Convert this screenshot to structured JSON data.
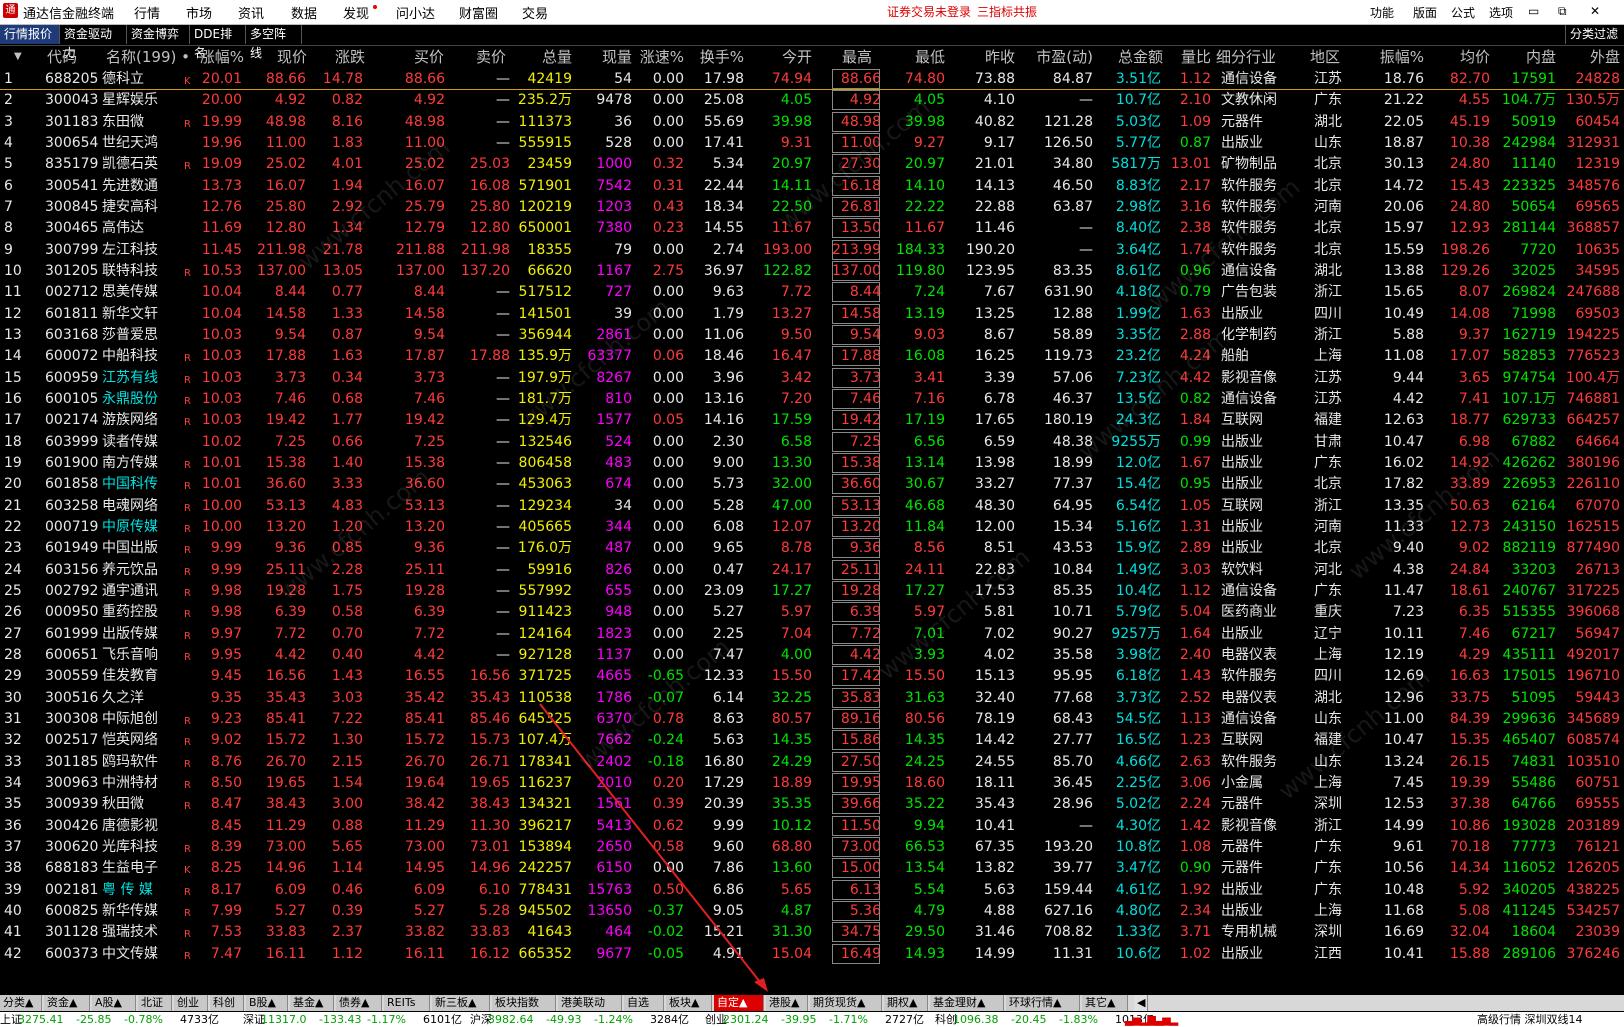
{
  "app": {
    "title": "通达信金融终端",
    "logo": "通"
  },
  "topmenu": [
    "行情",
    "市场",
    "资讯",
    "数据",
    "发现",
    "问小达",
    "财富圈",
    "交易"
  ],
  "alerts": [
    "证券交易未登录",
    "三指标共振"
  ],
  "rightmenu": [
    "功能",
    "版面",
    "公式",
    "选项"
  ],
  "tabs": [
    "行情报价",
    "资金驱动力",
    "资金博弈",
    "DDE排名",
    "多空阵线"
  ],
  "right_tab": "分类过滤",
  "headers": [
    "代码",
    "名称(199) •",
    "涨幅%",
    "现价",
    "涨跌",
    "买价",
    "卖价",
    "总量",
    "现量",
    "涨速%",
    "换手%",
    "今开",
    "最高",
    "最低",
    "昨收",
    "市盈(动)",
    "总金额",
    "量比",
    "细分行业",
    "地区",
    "振幅%",
    "均价",
    "内盘",
    "外盘"
  ],
  "rows": [
    [
      "1",
      "688205",
      "德科立",
      "K",
      "20.01",
      "88.66",
      "14.78",
      "88.66",
      "—",
      "42419",
      "54",
      "0.00",
      "17.98",
      "74.94",
      "88.66",
      "74.80",
      "73.88",
      "84.87",
      "3.51亿",
      "1.12",
      "通信设备",
      "江苏",
      "18.76",
      "82.70",
      "17591",
      "24828"
    ],
    [
      "2",
      "300043",
      "星辉娱乐",
      "",
      "20.00",
      "4.92",
      "0.82",
      "4.92",
      "—",
      "235.2万",
      "9478",
      "0.00",
      "25.08",
      "4.05",
      "4.92",
      "4.05",
      "4.10",
      "—",
      "10.7亿",
      "2.10",
      "文教休闲",
      "广东",
      "21.22",
      "4.55",
      "104.7万",
      "130.5万"
    ],
    [
      "3",
      "301183",
      "东田微",
      "R",
      "19.99",
      "48.98",
      "8.16",
      "48.98",
      "—",
      "111373",
      "36",
      "0.00",
      "55.69",
      "39.98",
      "48.98",
      "39.98",
      "40.82",
      "121.28",
      "5.03亿",
      "1.09",
      "元器件",
      "湖北",
      "22.05",
      "45.19",
      "50919",
      "60454"
    ],
    [
      "4",
      "300654",
      "世纪天鸿",
      "",
      "19.96",
      "11.00",
      "1.83",
      "11.00",
      "—",
      "555915",
      "528",
      "0.00",
      "17.41",
      "9.31",
      "11.00",
      "9.27",
      "9.17",
      "126.50",
      "5.77亿",
      "0.87",
      "出版业",
      "山东",
      "18.87",
      "10.38",
      "242984",
      "312931"
    ],
    [
      "5",
      "835179",
      "凯德石英",
      "R",
      "19.09",
      "25.02",
      "4.01",
      "25.02",
      "25.03",
      "23459",
      "1000",
      "0.32",
      "5.34",
      "20.97",
      "27.30",
      "20.97",
      "21.01",
      "34.80",
      "5817万",
      "13.01",
      "矿物制品",
      "北京",
      "30.13",
      "24.80",
      "11140",
      "12319"
    ],
    [
      "6",
      "300541",
      "先进数通",
      "",
      "13.73",
      "16.07",
      "1.94",
      "16.07",
      "16.08",
      "571901",
      "7542",
      "0.31",
      "22.44",
      "14.11",
      "16.18",
      "14.10",
      "14.13",
      "46.50",
      "8.83亿",
      "2.17",
      "软件服务",
      "北京",
      "14.72",
      "15.43",
      "223325",
      "348576"
    ],
    [
      "7",
      "300845",
      "捷安高科",
      "",
      "12.76",
      "25.80",
      "2.92",
      "25.79",
      "25.80",
      "120219",
      "1203",
      "0.43",
      "18.34",
      "22.50",
      "26.81",
      "22.22",
      "22.88",
      "63.87",
      "2.98亿",
      "3.16",
      "软件服务",
      "河南",
      "20.06",
      "24.80",
      "50654",
      "69565"
    ],
    [
      "8",
      "300465",
      "高伟达",
      "",
      "11.69",
      "12.80",
      "1.34",
      "12.79",
      "12.80",
      "650001",
      "7380",
      "0.23",
      "14.55",
      "11.67",
      "13.50",
      "11.67",
      "11.46",
      "—",
      "8.40亿",
      "2.38",
      "软件服务",
      "北京",
      "15.97",
      "12.93",
      "281144",
      "368857"
    ],
    [
      "9",
      "300799",
      "左江科技",
      "",
      "11.45",
      "211.98",
      "21.78",
      "211.88",
      "211.98",
      "18355",
      "79",
      "0.00",
      "2.74",
      "193.00",
      "213.99",
      "184.33",
      "190.20",
      "—",
      "3.64亿",
      "1.74",
      "软件服务",
      "北京",
      "15.59",
      "198.26",
      "7720",
      "10635"
    ],
    [
      "10",
      "301205",
      "联特科技",
      "R",
      "10.53",
      "137.00",
      "13.05",
      "137.00",
      "137.20",
      "66620",
      "1167",
      "2.75",
      "36.97",
      "122.82",
      "137.00",
      "119.80",
      "123.95",
      "83.35",
      "8.61亿",
      "0.96",
      "通信设备",
      "湖北",
      "13.88",
      "129.26",
      "32025",
      "34595"
    ],
    [
      "11",
      "002712",
      "思美传媒",
      "",
      "10.04",
      "8.44",
      "0.77",
      "8.44",
      "—",
      "517512",
      "727",
      "0.00",
      "9.63",
      "7.72",
      "8.44",
      "7.24",
      "7.67",
      "631.90",
      "4.18亿",
      "0.79",
      "广告包装",
      "浙江",
      "15.65",
      "8.07",
      "269824",
      "247688"
    ],
    [
      "12",
      "601811",
      "新华文轩",
      "",
      "10.04",
      "14.58",
      "1.33",
      "14.58",
      "—",
      "141501",
      "39",
      "0.00",
      "1.79",
      "13.27",
      "14.58",
      "13.19",
      "13.25",
      "12.88",
      "1.99亿",
      "1.63",
      "出版业",
      "四川",
      "10.49",
      "14.08",
      "71998",
      "69503"
    ],
    [
      "13",
      "603168",
      "莎普爱思",
      "",
      "10.03",
      "9.54",
      "0.87",
      "9.54",
      "—",
      "356944",
      "2861",
      "0.00",
      "11.06",
      "9.50",
      "9.54",
      "9.03",
      "8.67",
      "58.89",
      "3.35亿",
      "2.88",
      "化学制药",
      "浙江",
      "5.88",
      "9.37",
      "162719",
      "194225"
    ],
    [
      "14",
      "600072",
      "中船科技",
      "R",
      "10.03",
      "17.88",
      "1.63",
      "17.87",
      "17.88",
      "135.9万",
      "63377",
      "0.06",
      "18.46",
      "16.47",
      "17.88",
      "16.08",
      "16.25",
      "119.73",
      "23.2亿",
      "4.24",
      "船舶",
      "上海",
      "11.08",
      "17.07",
      "582853",
      "776523"
    ],
    [
      "15",
      "600959",
      "江苏有线",
      "R",
      "10.03",
      "3.73",
      "0.34",
      "3.73",
      "—",
      "197.9万",
      "8267",
      "0.00",
      "3.96",
      "3.42",
      "3.73",
      "3.41",
      "3.39",
      "57.06",
      "7.23亿",
      "4.42",
      "影视音像",
      "江苏",
      "9.44",
      "3.65",
      "974754",
      "100.4万"
    ],
    [
      "16",
      "600105",
      "永鼎股份",
      "R",
      "10.03",
      "7.46",
      "0.68",
      "7.46",
      "—",
      "181.7万",
      "810",
      "0.00",
      "13.16",
      "7.20",
      "7.46",
      "7.16",
      "6.78",
      "46.37",
      "13.5亿",
      "0.82",
      "通信设备",
      "江苏",
      "4.42",
      "7.41",
      "107.1万",
      "746881"
    ],
    [
      "17",
      "002174",
      "游族网络",
      "R",
      "10.03",
      "19.42",
      "1.77",
      "19.42",
      "—",
      "129.4万",
      "1577",
      "0.05",
      "14.16",
      "17.59",
      "19.42",
      "17.19",
      "17.65",
      "180.19",
      "24.3亿",
      "1.84",
      "互联网",
      "福建",
      "12.63",
      "18.77",
      "629733",
      "664257"
    ],
    [
      "18",
      "603999",
      "读者传媒",
      "",
      "10.02",
      "7.25",
      "0.66",
      "7.25",
      "—",
      "132546",
      "524",
      "0.00",
      "2.30",
      "6.58",
      "7.25",
      "6.56",
      "6.59",
      "48.38",
      "9255万",
      "0.99",
      "出版业",
      "甘肃",
      "10.47",
      "6.98",
      "67882",
      "64664"
    ],
    [
      "19",
      "601900",
      "南方传媒",
      "R",
      "10.01",
      "15.38",
      "1.40",
      "15.38",
      "—",
      "806458",
      "483",
      "0.00",
      "9.00",
      "13.30",
      "15.38",
      "13.14",
      "13.98",
      "18.99",
      "12.0亿",
      "1.67",
      "出版业",
      "广东",
      "16.02",
      "14.92",
      "426262",
      "380196"
    ],
    [
      "20",
      "601858",
      "中国科传",
      "R",
      "10.01",
      "36.60",
      "3.33",
      "36.60",
      "—",
      "453063",
      "674",
      "0.00",
      "5.73",
      "32.00",
      "36.60",
      "30.67",
      "33.27",
      "77.37",
      "15.4亿",
      "0.95",
      "出版业",
      "北京",
      "17.82",
      "33.89",
      "226953",
      "226110"
    ],
    [
      "21",
      "603258",
      "电魂网络",
      "R",
      "10.00",
      "53.13",
      "4.83",
      "53.13",
      "—",
      "129234",
      "34",
      "0.00",
      "5.28",
      "47.00",
      "53.13",
      "46.68",
      "48.30",
      "64.95",
      "6.54亿",
      "1.05",
      "互联网",
      "浙江",
      "13.35",
      "50.63",
      "62164",
      "67070"
    ],
    [
      "22",
      "000719",
      "中原传媒",
      "R",
      "10.00",
      "13.20",
      "1.20",
      "13.20",
      "—",
      "405665",
      "344",
      "0.00",
      "6.08",
      "12.07",
      "13.20",
      "11.84",
      "12.00",
      "15.34",
      "5.16亿",
      "1.31",
      "出版业",
      "河南",
      "11.33",
      "12.73",
      "243150",
      "162515"
    ],
    [
      "23",
      "601949",
      "中国出版",
      "R",
      "9.99",
      "9.36",
      "0.85",
      "9.36",
      "—",
      "176.0万",
      "487",
      "0.00",
      "9.65",
      "8.78",
      "9.36",
      "8.56",
      "8.51",
      "43.53",
      "15.9亿",
      "2.89",
      "出版业",
      "北京",
      "9.40",
      "9.02",
      "882119",
      "877490"
    ],
    [
      "24",
      "603156",
      "养元饮品",
      "R",
      "9.99",
      "25.11",
      "2.28",
      "25.11",
      "—",
      "59916",
      "826",
      "0.00",
      "0.47",
      "24.17",
      "25.11",
      "24.11",
      "22.83",
      "10.84",
      "1.49亿",
      "3.03",
      "软饮料",
      "河北",
      "4.38",
      "24.84",
      "33203",
      "26713"
    ],
    [
      "25",
      "002792",
      "通宇通讯",
      "R",
      "9.98",
      "19.28",
      "1.75",
      "19.28",
      "—",
      "557992",
      "655",
      "0.00",
      "23.09",
      "17.27",
      "19.28",
      "17.27",
      "17.53",
      "85.35",
      "10.4亿",
      "1.12",
      "通信设备",
      "广东",
      "11.47",
      "18.61",
      "240767",
      "317225"
    ],
    [
      "26",
      "000950",
      "重药控股",
      "R",
      "9.98",
      "6.39",
      "0.58",
      "6.39",
      "—",
      "911423",
      "948",
      "0.00",
      "5.27",
      "5.97",
      "6.39",
      "5.97",
      "5.81",
      "10.71",
      "5.79亿",
      "5.04",
      "医药商业",
      "重庆",
      "7.23",
      "6.35",
      "515355",
      "396068"
    ],
    [
      "27",
      "601999",
      "出版传媒",
      "R",
      "9.97",
      "7.72",
      "0.70",
      "7.72",
      "—",
      "124164",
      "1823",
      "0.00",
      "2.25",
      "7.04",
      "7.72",
      "7.01",
      "7.02",
      "90.27",
      "9257万",
      "1.64",
      "出版业",
      "辽宁",
      "10.11",
      "7.46",
      "67217",
      "56947"
    ],
    [
      "28",
      "600651",
      "飞乐音响",
      "R",
      "9.95",
      "4.42",
      "0.40",
      "4.42",
      "—",
      "927128",
      "1137",
      "0.00",
      "7.47",
      "4.00",
      "4.42",
      "3.93",
      "4.02",
      "35.58",
      "3.98亿",
      "2.40",
      "电器仪表",
      "上海",
      "12.19",
      "4.29",
      "435111",
      "492017"
    ],
    [
      "29",
      "300559",
      "佳发教育",
      "",
      "9.45",
      "16.56",
      "1.43",
      "16.55",
      "16.56",
      "371725",
      "4665",
      "-0.65",
      "12.33",
      "15.50",
      "17.42",
      "15.50",
      "15.13",
      "95.95",
      "6.18亿",
      "1.43",
      "软件服务",
      "四川",
      "12.69",
      "16.63",
      "175015",
      "196710"
    ],
    [
      "30",
      "300516",
      "久之洋",
      "",
      "9.35",
      "35.43",
      "3.03",
      "35.42",
      "35.43",
      "110538",
      "1786",
      "-0.07",
      "6.14",
      "32.25",
      "35.83",
      "31.63",
      "32.40",
      "77.68",
      "3.73亿",
      "2.52",
      "电器仪表",
      "湖北",
      "12.96",
      "33.75",
      "51095",
      "59443"
    ],
    [
      "31",
      "300308",
      "中际旭创",
      "R",
      "9.23",
      "85.41",
      "7.22",
      "85.41",
      "85.46",
      "645325",
      "6370",
      "0.78",
      "8.63",
      "80.57",
      "89.16",
      "80.56",
      "78.19",
      "68.43",
      "54.5亿",
      "1.13",
      "通信设备",
      "山东",
      "11.00",
      "84.39",
      "299636",
      "345689"
    ],
    [
      "32",
      "002517",
      "恺英网络",
      "R",
      "9.02",
      "15.72",
      "1.30",
      "15.72",
      "15.73",
      "107.4万",
      "7662",
      "-0.24",
      "5.63",
      "14.35",
      "15.86",
      "14.35",
      "14.42",
      "27.77",
      "16.5亿",
      "1.23",
      "互联网",
      "福建",
      "10.47",
      "15.35",
      "465407",
      "608574"
    ],
    [
      "33",
      "301185",
      "鸥玛软件",
      "R",
      "8.76",
      "26.70",
      "2.15",
      "26.70",
      "26.71",
      "178341",
      "2402",
      "-0.18",
      "16.80",
      "24.29",
      "27.50",
      "24.25",
      "24.55",
      "85.70",
      "4.66亿",
      "2.63",
      "软件服务",
      "山东",
      "13.24",
      "26.15",
      "74831",
      "103510"
    ],
    [
      "34",
      "300963",
      "中洲特材",
      "R",
      "8.50",
      "19.65",
      "1.54",
      "19.64",
      "19.65",
      "116237",
      "2010",
      "0.20",
      "17.29",
      "18.89",
      "19.95",
      "18.60",
      "18.11",
      "36.45",
      "2.25亿",
      "3.06",
      "小金属",
      "上海",
      "7.45",
      "19.39",
      "55486",
      "60751"
    ],
    [
      "35",
      "300939",
      "秋田微",
      "R",
      "8.47",
      "38.43",
      "3.00",
      "38.42",
      "38.43",
      "134321",
      "1561",
      "0.39",
      "20.39",
      "35.35",
      "39.66",
      "35.22",
      "35.43",
      "28.96",
      "5.02亿",
      "2.24",
      "元器件",
      "深圳",
      "12.53",
      "37.38",
      "64766",
      "69555"
    ],
    [
      "36",
      "300426",
      "唐德影视",
      "",
      "8.45",
      "11.29",
      "0.88",
      "11.29",
      "11.30",
      "396217",
      "5413",
      "0.62",
      "9.99",
      "10.12",
      "11.50",
      "9.94",
      "10.41",
      "—",
      "4.30亿",
      "1.42",
      "影视音像",
      "浙江",
      "14.99",
      "10.86",
      "193028",
      "203189"
    ],
    [
      "37",
      "300620",
      "光库科技",
      "R",
      "8.39",
      "73.00",
      "5.65",
      "73.00",
      "73.01",
      "153894",
      "2650",
      "0.58",
      "9.60",
      "68.80",
      "73.00",
      "66.53",
      "67.35",
      "193.20",
      "10.8亿",
      "1.08",
      "元器件",
      "广东",
      "9.61",
      "70.18",
      "77773",
      "76121"
    ],
    [
      "38",
      "688183",
      "生益电子",
      "K",
      "8.25",
      "14.96",
      "1.14",
      "14.95",
      "14.96",
      "242257",
      "6150",
      "0.00",
      "7.86",
      "13.60",
      "15.00",
      "13.54",
      "13.82",
      "39.77",
      "3.47亿",
      "0.90",
      "元器件",
      "广东",
      "10.56",
      "14.34",
      "116052",
      "126205"
    ],
    [
      "39",
      "002181",
      "粤 传 媒",
      "R",
      "8.17",
      "6.09",
      "0.46",
      "6.09",
      "6.10",
      "778431",
      "15763",
      "0.50",
      "6.86",
      "5.65",
      "6.13",
      "5.54",
      "5.63",
      "159.44",
      "4.61亿",
      "1.92",
      "出版业",
      "广东",
      "10.48",
      "5.92",
      "340205",
      "438225"
    ],
    [
      "40",
      "600825",
      "新华传媒",
      "R",
      "7.99",
      "5.27",
      "0.39",
      "5.27",
      "5.28",
      "945502",
      "13650",
      "-0.37",
      "9.05",
      "4.87",
      "5.36",
      "4.79",
      "4.88",
      "627.16",
      "4.80亿",
      "2.34",
      "出版业",
      "上海",
      "11.68",
      "5.08",
      "411245",
      "534257"
    ],
    [
      "41",
      "301128",
      "强瑞技术",
      "R",
      "7.53",
      "33.83",
      "2.37",
      "33.82",
      "33.83",
      "41643",
      "464",
      "-0.02",
      "15.21",
      "31.30",
      "34.75",
      "29.50",
      "31.46",
      "708.82",
      "1.33亿",
      "3.71",
      "专用机械",
      "深圳",
      "16.69",
      "32.04",
      "18604",
      "23039"
    ],
    [
      "42",
      "600373",
      "中文传媒",
      "R",
      "7.47",
      "16.11",
      "1.12",
      "16.11",
      "16.12",
      "665352",
      "9677",
      "-0.05",
      "4.91",
      "15.04",
      "16.49",
      "14.93",
      "14.99",
      "11.31",
      "10.6亿",
      "1.02",
      "出版业",
      "江西",
      "10.41",
      "15.88",
      "289106",
      "376246"
    ]
  ],
  "cyan_names": [
    "江苏有线",
    "永鼎股份",
    "中国科传",
    "中原传媒",
    "粤 传 媒"
  ],
  "bottom_tabs": [
    "分类▲",
    "资金▲",
    "A股▲",
    "北证",
    "创业",
    "科创",
    "B股▲",
    "基金▲",
    "债券▲",
    "REITs",
    "新三板▲",
    "板块指数",
    "港美联动",
    "自选",
    "板块▲",
    "自定▲",
    "港股▲",
    "期货现货▲",
    "期权▲",
    "基金理财▲",
    "环球行情▲",
    "其它▲"
  ],
  "active_bottom_tab": "自定▲",
  "status": {
    "sh": [
      "上证",
      "3275.41",
      "-25.85",
      "-0.78%",
      "4733亿"
    ],
    "sz": [
      "深证",
      "11317.0",
      "-133.43",
      "-1.17%",
      "6101亿"
    ],
    "hs": [
      "沪深",
      "3982.64",
      "-49.93",
      "-1.24%",
      "3284亿"
    ],
    "cy": [
      "创业",
      "2301.24",
      "-39.95",
      "-1.71%",
      "2727亿"
    ],
    "kc": [
      "科创",
      "1096.38",
      "-20.45",
      "-1.83%",
      "1013亿"
    ],
    "right": "高级行情 深圳双线14"
  },
  "watermark": "www.cfcnh.com",
  "colors": {
    "up": "#ff3b3b",
    "down": "#00e400",
    "vol": "#f0f000",
    "cur": "#ff00ff",
    "amt": "#00e0e0",
    "arrow": "#e02020"
  }
}
